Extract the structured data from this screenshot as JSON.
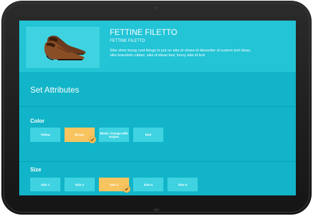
{
  "product": {
    "name": "FETTINE FILETTO",
    "subtitle": "FETTINE FILETTO",
    "description": "Sike shoe toung cool things to put on sike id shoes id ideasnike id custom text ideas, sike bracelets rubber, sike id ideas text, funny sike id text"
  },
  "attributes_title": "Set Attributes",
  "color": {
    "label": "Color",
    "options": [
      "Yellow",
      "Brown",
      "Black, Orange with stripes",
      "Red"
    ],
    "selected": "Brown"
  },
  "size": {
    "label": "Size",
    "options": [
      "Size 1",
      "Size 2",
      "Size 3",
      "Size 4",
      "Size 5"
    ],
    "selected": "Size 3"
  },
  "colors": {
    "screen_bg": "#11b4c8",
    "header_bg": "#22c4d6",
    "option_bg": "#3fd3e2",
    "selected_bg": "#f8c45f",
    "bezel": "#1c1c1c"
  }
}
